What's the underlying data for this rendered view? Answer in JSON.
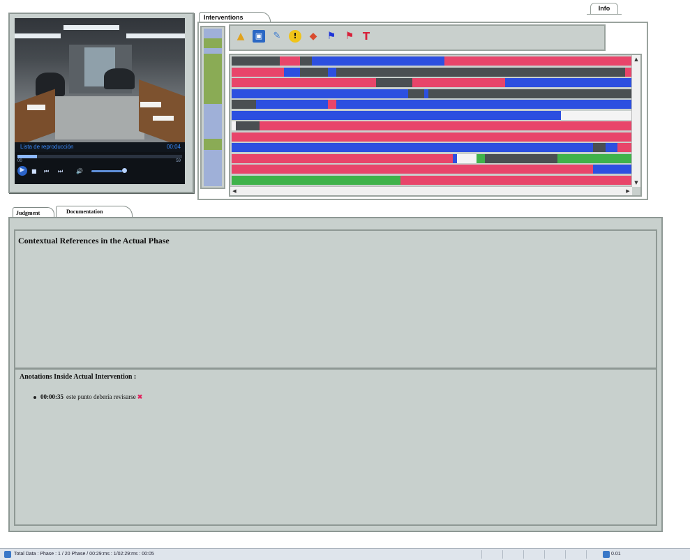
{
  "header": {
    "info_tab": "Info"
  },
  "video": {
    "caption": "Lista de reproducción",
    "caption_time": "00:04",
    "time_elapsed": "00",
    "time_total": "59",
    "progress_fraction": 0.12,
    "volume_fraction": 0.85,
    "icons": [
      "play-icon",
      "stop-icon",
      "previous-icon",
      "next-icon",
      "volume-icon"
    ]
  },
  "interventions": {
    "tab_label": "Interventions",
    "toolbar_icons": [
      "chart-icon",
      "save-icon",
      "edit-icon",
      "warning-icon",
      "puzzle-icon",
      "blue-flag-icon",
      "red-flag-icon",
      "pin-icon"
    ],
    "colors": {
      "red": "#e8456a",
      "blue": "#2c4fe0",
      "dark": "#4a4f52",
      "green": "#3fb24a",
      "white": "#f4f4f4"
    }
  },
  "bottom_tabs": {
    "judgment": "Judgment",
    "documentation": "Documentation"
  },
  "documentation": {
    "heading": "Contextual References in the Actual Phase",
    "annotations_heading": "Anotations Inside Actual Intervention :",
    "annotations": [
      {
        "time": "00:00:35",
        "text": "este punto debería revisarse"
      }
    ]
  },
  "statusbar": {
    "text": "Total Data : Phase : 1 / 20 Phase / 00:29:ms : 1/02:29:ms : 00:05",
    "right": "0.01"
  }
}
